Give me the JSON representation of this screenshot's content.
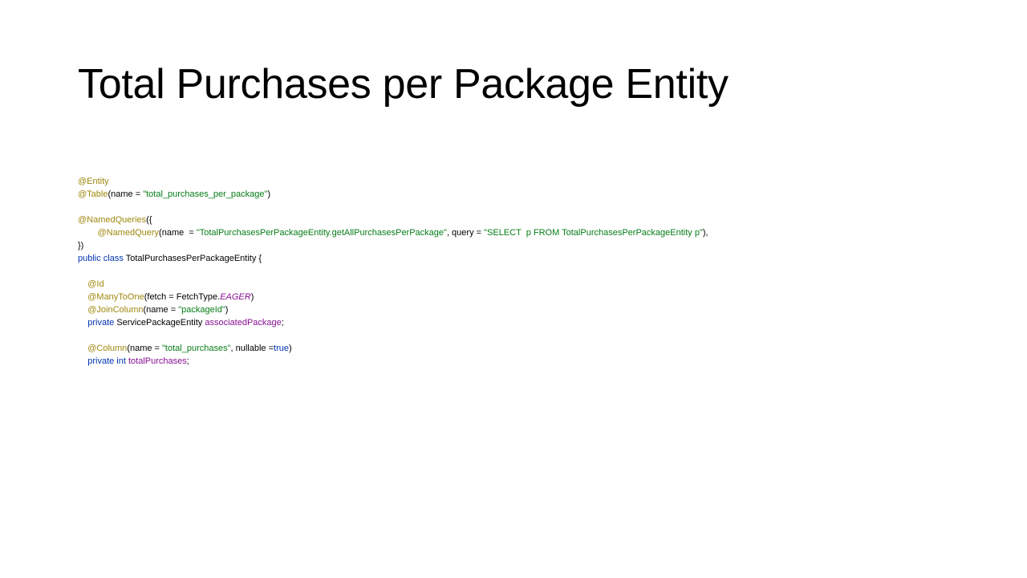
{
  "slide": {
    "title": "Total Purchases per Package Entity"
  },
  "code": {
    "lines": [
      [
        {
          "t": "@Entity",
          "k": "ann"
        }
      ],
      [
        {
          "t": "@Table",
          "k": "ann"
        },
        {
          "t": "(name = ",
          "k": "pl"
        },
        {
          "t": "\"total_purchases_per_package\"",
          "k": "str"
        },
        {
          "t": ")",
          "k": "pl"
        }
      ],
      [],
      [
        {
          "t": "@NamedQueries",
          "k": "ann"
        },
        {
          "t": "({",
          "k": "pl"
        }
      ],
      [
        {
          "t": "        ",
          "k": "pl"
        },
        {
          "t": "@NamedQuery",
          "k": "ann"
        },
        {
          "t": "(name  = ",
          "k": "pl"
        },
        {
          "t": "\"TotalPurchasesPerPackageEntity.getAllPurchasesPerPackage\"",
          "k": "str"
        },
        {
          "t": ", query = ",
          "k": "pl"
        },
        {
          "t": "\"SELECT  p FROM TotalPurchasesPerPackageEntity p\"",
          "k": "str"
        },
        {
          "t": "),",
          "k": "pl"
        }
      ],
      [
        {
          "t": "})",
          "k": "pl"
        }
      ],
      [
        {
          "t": "public class ",
          "k": "kw"
        },
        {
          "t": "TotalPurchasesPerPackageEntity {",
          "k": "pl"
        }
      ],
      [],
      [
        {
          "t": "    ",
          "k": "pl"
        },
        {
          "t": "@Id",
          "k": "ann"
        }
      ],
      [
        {
          "t": "    ",
          "k": "pl"
        },
        {
          "t": "@ManyToOne",
          "k": "ann"
        },
        {
          "t": "(fetch = FetchType.",
          "k": "pl"
        },
        {
          "t": "EAGER",
          "k": "itl"
        },
        {
          "t": ")",
          "k": "pl"
        }
      ],
      [
        {
          "t": "    ",
          "k": "pl"
        },
        {
          "t": "@JoinColumn",
          "k": "ann"
        },
        {
          "t": "(name = ",
          "k": "pl"
        },
        {
          "t": "\"packageId\"",
          "k": "str"
        },
        {
          "t": ")",
          "k": "pl"
        }
      ],
      [
        {
          "t": "    ",
          "k": "pl"
        },
        {
          "t": "private ",
          "k": "kw"
        },
        {
          "t": "ServicePackageEntity ",
          "k": "pl"
        },
        {
          "t": "associatedPackage",
          "k": "fld"
        },
        {
          "t": ";",
          "k": "pl"
        }
      ],
      [],
      [
        {
          "t": "    ",
          "k": "pl"
        },
        {
          "t": "@Column",
          "k": "ann"
        },
        {
          "t": "(name = ",
          "k": "pl"
        },
        {
          "t": "\"total_purchases\"",
          "k": "str"
        },
        {
          "t": ", nullable =",
          "k": "pl"
        },
        {
          "t": "true",
          "k": "kw"
        },
        {
          "t": ")",
          "k": "pl"
        }
      ],
      [
        {
          "t": "    ",
          "k": "pl"
        },
        {
          "t": "private int ",
          "k": "kw"
        },
        {
          "t": "totalPurchases",
          "k": "fld"
        },
        {
          "t": ";",
          "k": "pl"
        }
      ]
    ]
  },
  "colors": {
    "annotation": "#9e880d",
    "string": "#067d17",
    "keyword": "#0033b3",
    "field": "#871094",
    "text": "#000000",
    "background": "#ffffff"
  }
}
